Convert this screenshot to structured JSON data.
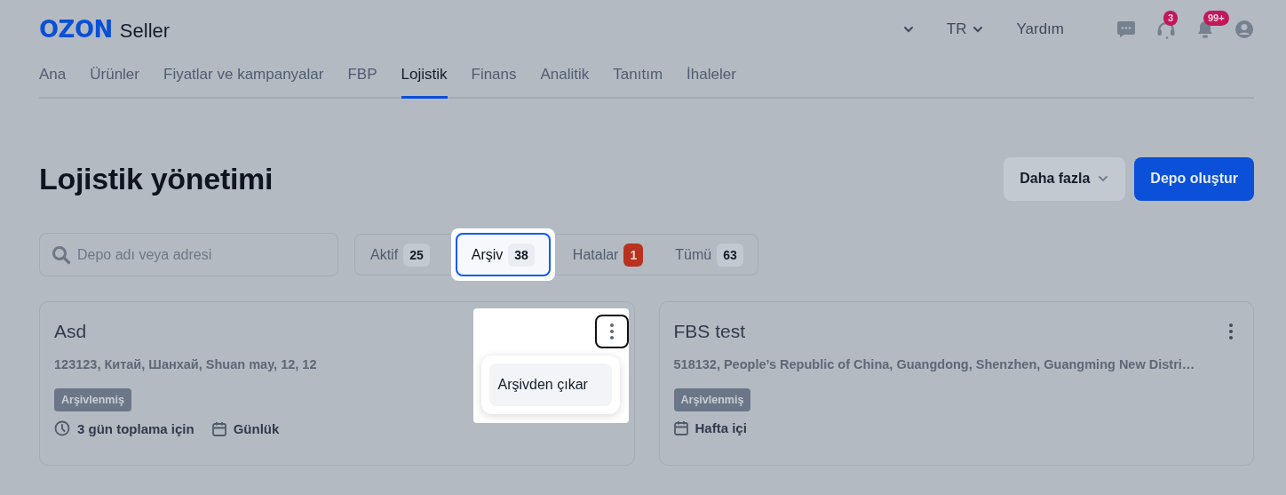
{
  "header": {
    "logo": "OZON",
    "product": "Seller",
    "language": "TR",
    "help": "Yardım",
    "icons": [
      {
        "kind": "chat"
      },
      {
        "kind": "headset",
        "badge": "3"
      },
      {
        "kind": "bell",
        "badge": "99+"
      },
      {
        "kind": "profile"
      }
    ]
  },
  "nav": [
    {
      "label": "Ana",
      "selected": false
    },
    {
      "label": "Ürünler",
      "selected": false
    },
    {
      "label": "Fiyatlar ve kampanyalar",
      "selected": false
    },
    {
      "label": "FBP",
      "selected": false
    },
    {
      "label": "Lojistik",
      "selected": true
    },
    {
      "label": "Finans",
      "selected": false
    },
    {
      "label": "Analitik",
      "selected": false
    },
    {
      "label": "Tanıtım",
      "selected": false
    },
    {
      "label": "İhaleler",
      "selected": false
    }
  ],
  "page_title": "Lojistik yönetimi",
  "actions": [
    {
      "label": "Daha fazla",
      "kind": "secondary"
    },
    {
      "label": "Depo oluştur",
      "kind": "primary"
    }
  ],
  "search": {
    "placeholder": "Depo adı veya adresi"
  },
  "filter_tabs": [
    {
      "label": "Aktif",
      "count": "25",
      "kind": "normal",
      "selected": false
    },
    {
      "label": "Arşiv",
      "count": "38",
      "kind": "normal",
      "selected": true
    },
    {
      "label": "Hatalar",
      "count": "1",
      "kind": "error",
      "selected": false
    },
    {
      "label": "Tümü",
      "count": "63",
      "kind": "normal",
      "selected": false
    }
  ],
  "warehouses": [
    {
      "name": "Asd",
      "address": "123123, Китай, Шанхай, Shuan may, 12, 12",
      "status": "Arşivlenmiş",
      "menu_open": true,
      "menu_items": [
        "Arşivden çıkar"
      ],
      "schedule": [
        {
          "kind": "clock",
          "text": "3 gün toplama için"
        },
        {
          "kind": "calendar",
          "text": "Günlük"
        }
      ]
    },
    {
      "name": "FBS test",
      "address": "518132, People’s Republic of China, Guangdong, Shenzhen, Guangming New Distri…",
      "status": "Arşivlenmiş",
      "menu_open": false,
      "schedule": [
        {
          "kind": "calendar",
          "text": "Hafta içi"
        }
      ]
    }
  ]
}
